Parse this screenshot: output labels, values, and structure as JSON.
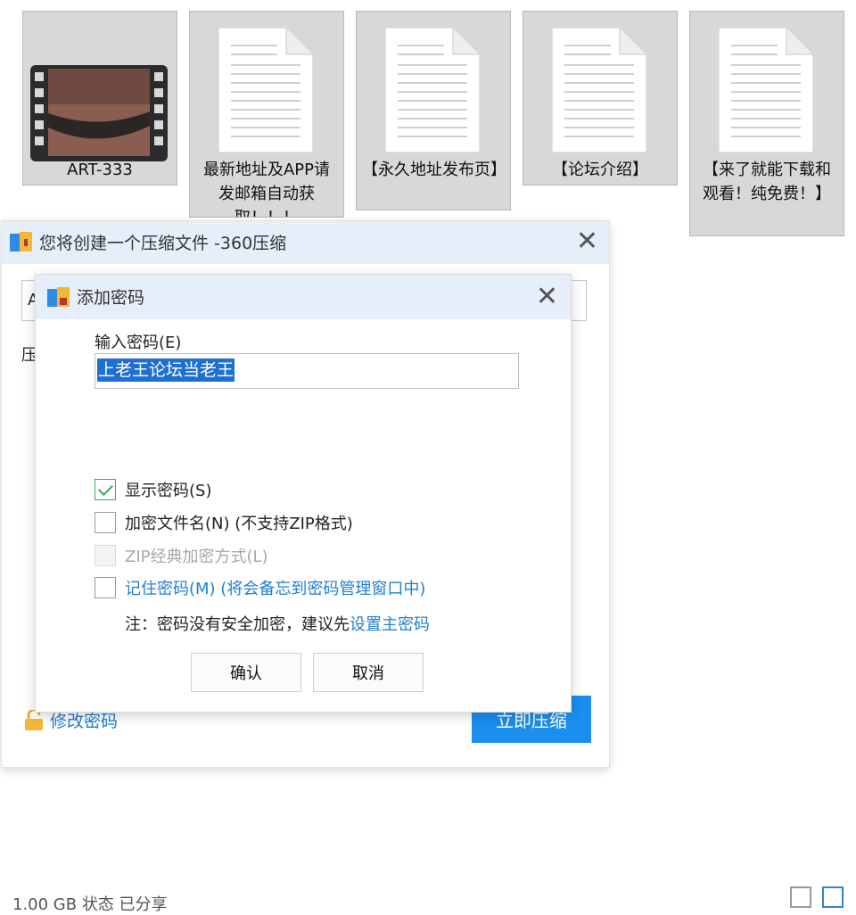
{
  "files": [
    {
      "name": "ART-333",
      "type": "video"
    },
    {
      "name": "最新地址及APP请发邮箱自动获取！！！",
      "type": "document"
    },
    {
      "name": "【永久地址发布页】",
      "type": "document"
    },
    {
      "name": "【论坛介绍】",
      "type": "document"
    },
    {
      "name": "【来了就能下载和观看！纯免费！】",
      "type": "document"
    }
  ],
  "main_dialog": {
    "title": "您将创建一个压缩文件 -360压缩",
    "close_symbol": "✕",
    "path_prefix": "A",
    "label_prefix": "压",
    "edit_password": "修改密码",
    "compress_now": "立即压缩"
  },
  "password_dialog": {
    "title": "添加密码",
    "close_symbol": "✕",
    "input_label": "输入密码(E)",
    "password_value": "上老王论坛当老王",
    "options": {
      "show_password": {
        "label": "显示密码(S)",
        "checked": true
      },
      "encrypt_filenames": {
        "label": "加密文件名(N) (不支持ZIP格式)",
        "checked": false
      },
      "zip_classic": {
        "label": "ZIP经典加密方式(L)",
        "checked": false,
        "disabled": true
      },
      "remember_password": {
        "label": "记住密码(M) (将会备忘到密码管理窗口中)",
        "checked": false
      }
    },
    "note_prefix": "注：密码没有安全加密，建议先",
    "note_link": "设置主密码",
    "confirm": "确认",
    "cancel": "取消"
  },
  "status_bar": {
    "left_text": "1.00 GB   状态  已分享"
  },
  "colors": {
    "titlebar": "#e5eef9",
    "accent": "#1a8fee",
    "link": "#1f7fd0",
    "check_green": "#3aa860",
    "selection": "#1e6fd0"
  }
}
